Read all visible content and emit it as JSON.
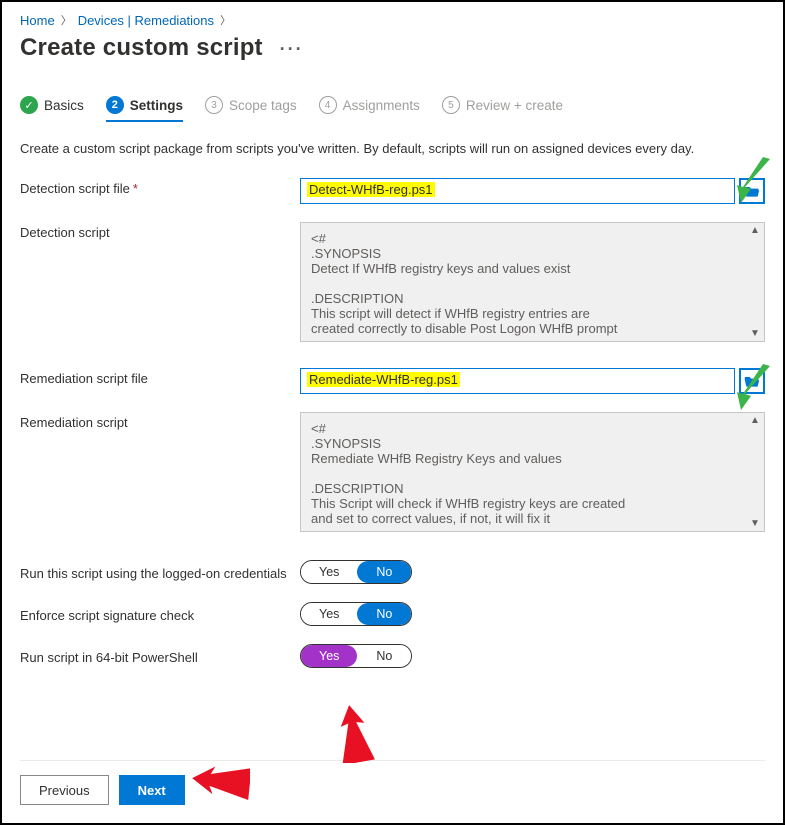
{
  "breadcrumb": {
    "home": "Home",
    "devices": "Devices | Remediations"
  },
  "page_title": "Create custom script",
  "tabs": [
    {
      "label": "Basics",
      "state": "completed",
      "icon": "✓"
    },
    {
      "label": "Settings",
      "state": "active",
      "num": "2"
    },
    {
      "label": "Scope tags",
      "state": "disabled",
      "num": "3"
    },
    {
      "label": "Assignments",
      "state": "disabled",
      "num": "4"
    },
    {
      "label": "Review + create",
      "state": "disabled",
      "num": "5"
    }
  ],
  "intro": "Create a custom script package from scripts you've written. By default, scripts will run on assigned devices every day.",
  "fields": {
    "detection_file_label": "Detection script file",
    "detection_file_value": "Detect-WHfB-reg.ps1",
    "detection_script_label": "Detection script",
    "detection_script_value": "<#\n.SYNOPSIS\nDetect If WHfB registry keys and values exist\n\n.DESCRIPTION\nThis script will detect if WHfB registry entries are\ncreated correctly to disable Post Logon WHfB prompt",
    "remediation_file_label": "Remediation script file",
    "remediation_file_value": "Remediate-WHfB-reg.ps1",
    "remediation_script_label": "Remediation script",
    "remediation_script_value": "<#\n.SYNOPSIS\nRemediate WHfB Registry Keys and values\n\n.DESCRIPTION\nThis Script will check if WHfB registry keys are created\nand set to correct values, if not, it will fix it"
  },
  "toggles": {
    "run_logged_on": {
      "label": "Run this script using the logged-on credentials",
      "yes": "Yes",
      "no": "No",
      "selected": "No"
    },
    "enforce_sig": {
      "label": "Enforce script signature check",
      "yes": "Yes",
      "no": "No",
      "selected": "No"
    },
    "run_64bit": {
      "label": "Run script in 64-bit PowerShell",
      "yes": "Yes",
      "no": "No",
      "selected": "Yes"
    }
  },
  "footer": {
    "previous": "Previous",
    "next": "Next"
  }
}
